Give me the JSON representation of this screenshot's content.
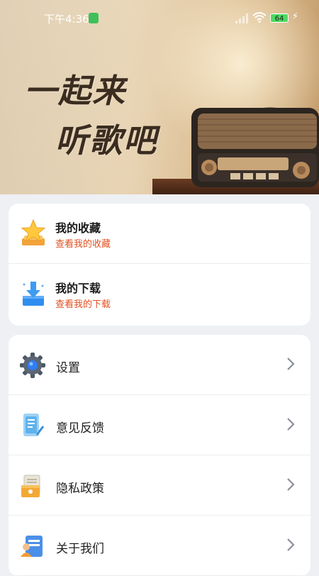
{
  "status_bar": {
    "time": "下午4:36",
    "battery_level": "64",
    "battery_color": "#4cd964"
  },
  "hero": {
    "line1": "一起来",
    "line2": "听歌吧"
  },
  "top_card": {
    "items": [
      {
        "title": "我的收藏",
        "subtitle": "查看我的收藏",
        "icon": "star-icon"
      },
      {
        "title": "我的下载",
        "subtitle": "查看我的下载",
        "icon": "download-icon"
      }
    ]
  },
  "menu": {
    "items": [
      {
        "label": "设置",
        "icon": "gear-icon"
      },
      {
        "label": "意见反馈",
        "icon": "feedback-icon"
      },
      {
        "label": "隐私政策",
        "icon": "privacy-icon"
      },
      {
        "label": "关于我们",
        "icon": "about-icon"
      }
    ]
  },
  "colors": {
    "accent_subtitle": "#e2501f",
    "page_background": "#eef0f4"
  }
}
